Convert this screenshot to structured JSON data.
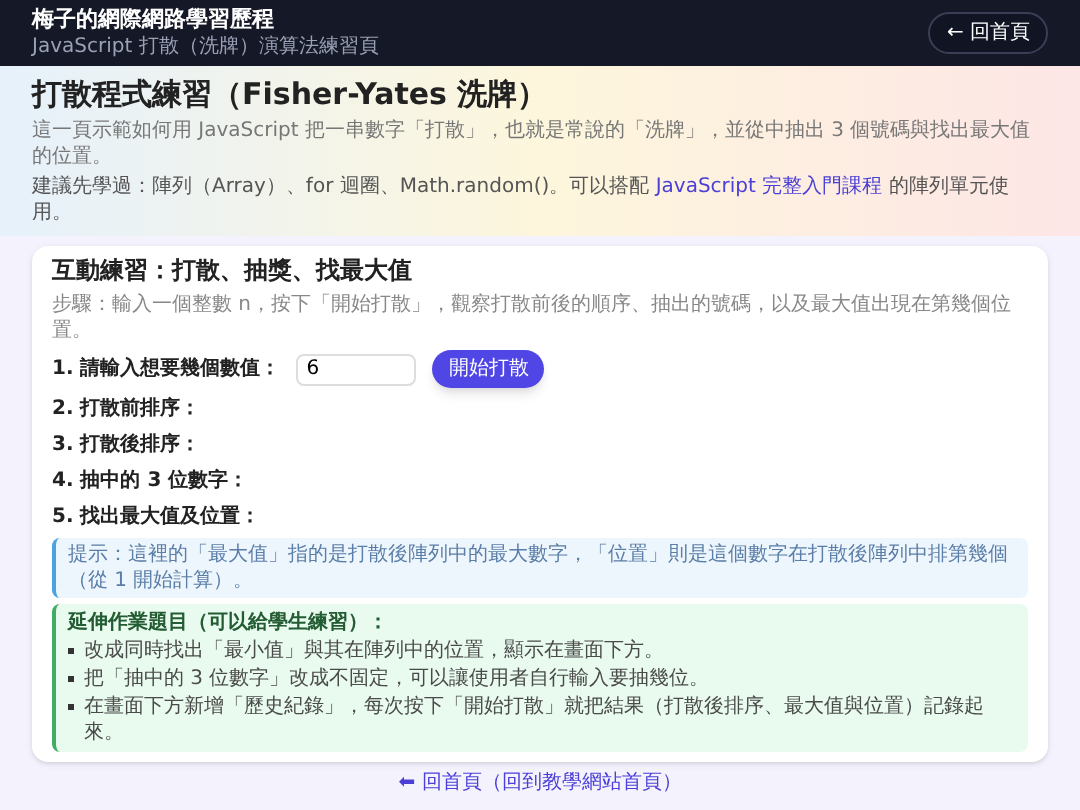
{
  "header": {
    "title": "梅子的網際網路學習歷程",
    "subtitle": "JavaScript 打散（洗牌）演算法練習頁",
    "back_button": "← 回首頁"
  },
  "hero": {
    "title": "打散程式練習（Fisher-Yates 洗牌）",
    "intro": "這一頁示範如何用 JavaScript 把一串數字「打散」，也就是常說的「洗牌」，並從中抽出 3 個號碼與找出最大值的位置。",
    "prereq": {
      "before": "建議先學過：陣列（Array）、for 迴圈、Math.random()。可以搭配 ",
      "link": "JavaScript 完整入門課程",
      "after": " 的陣列單元使用。"
    }
  },
  "exercise": {
    "title": "互動練習：打散、抽獎、找最大值",
    "steps": "步驟：輸入一個整數 n，按下「開始打散」，觀察打散前後的順序、抽出的號碼，以及最大值出現在第幾個位置。",
    "input_label": "1. 請輸入想要幾個數值：",
    "input_value": "6",
    "start_button": "開始打散",
    "outputs": [
      "2. 打散前排序：",
      "3. 打散後排序：",
      "4. 抽中的 3 位數字：",
      "5. 找出最大值及位置："
    ],
    "tip": "提示：這裡的「最大值」指的是打散後陣列中的最大數字，「位置」則是這個數字在打散後陣列中排第幾個（從 1 開始計算）。",
    "homework": {
      "title": "延伸作業題目（可以給學生練習）：",
      "items": [
        "改成同時找出「最小值」與其在陣列中的位置，顯示在畫面下方。",
        "把「抽中的 3 位數字」改成不固定，可以讓使用者自行輸入要抽幾位。",
        "在畫面下方新增「歷史紀錄」，每次按下「開始打散」就把結果（打散後排序、最大值與位置）記錄起來。"
      ]
    }
  },
  "footer_link": "⬅ 回首頁（回到教學網站首頁）"
}
